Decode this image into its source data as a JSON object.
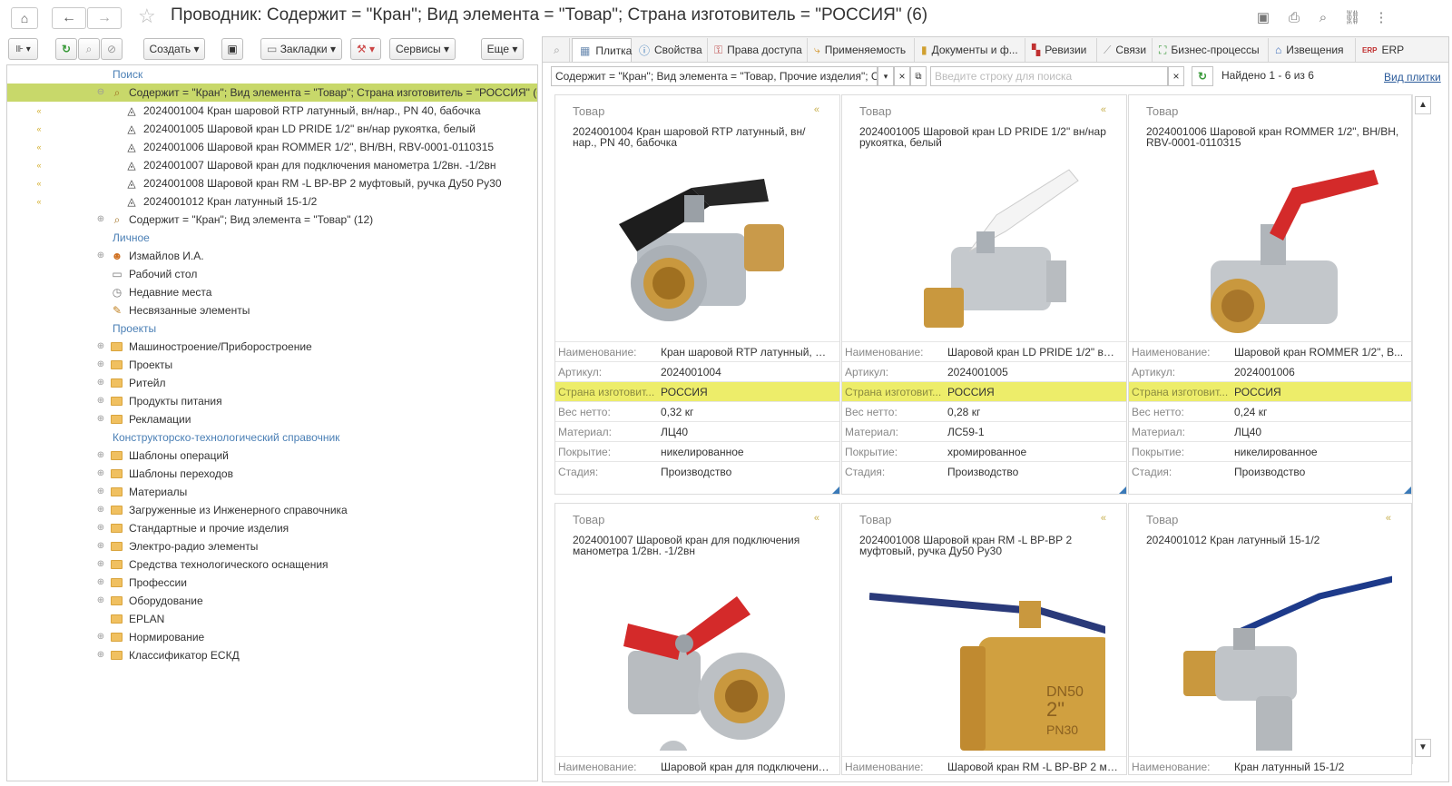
{
  "window": {
    "title": "Проводник: Содержит = \"Кран\"; Вид элемента = \"Товар\"; Страна изготовитель = \"РОССИЯ\" (6)"
  },
  "icons": [
    "home-icon",
    "back-icon",
    "forward-icon",
    "star-icon",
    "save-icon",
    "print-icon",
    "preview-icon",
    "link-icon",
    "more-vert-icon"
  ],
  "toolbar": {
    "create": "Создать",
    "bookmarks": "Закладки",
    "services": "Сервисы",
    "more": "Еще"
  },
  "tree": {
    "search_section": "Поиск",
    "query1": "Содержит = \"Кран\"; Вид элемента = \"Товар\"; Страна изготовитель = \"РОССИЯ\" (6)",
    "items": [
      "2024001004 Кран шаровой RTP латунный, вн/нар., PN 40, бабочка",
      "2024001005 Шаровой кран LD PRIDE 1/2\" вн/нар рукоятка, белый",
      "2024001006 Шаровой кран ROMMER 1/2\", ВН/ВН, RBV-0001-0110315",
      "2024001007 Шаровой кран для подключения манометра 1/2вн. -1/2вн",
      "2024001008 Шаровой кран RM -L ВР-ВР 2 муфтовый, ручка Ду50 Ру30",
      "2024001012 Кран латунный 15-1/2"
    ],
    "query2": "Содержит = \"Кран\"; Вид элемента = \"Товар\" (12)",
    "personal_section": "Личное",
    "personal": [
      "Измайлов И.А.",
      "Рабочий стол",
      "Недавние места",
      "Несвязанные элементы"
    ],
    "projects_section": "Проекты",
    "projects": [
      "Машиностроение/Приборостроение",
      "Проекты",
      "Ритейл",
      "Продукты питания",
      "Рекламации"
    ],
    "ktc_section": "Конструкторско-технологический справочник",
    "ktc": [
      "Шаблоны операций",
      "Шаблоны переходов",
      "Материалы",
      "Загруженные из Инженерного справочника",
      "Стандартные и прочие изделия",
      "Электро-радио элементы",
      "Средства технологического оснащения",
      "Профессии",
      "Оборудование",
      "EPLAN",
      "Нормирование",
      "Классификатор ЕСКД"
    ]
  },
  "tabs": [
    "Плитка",
    "Свойства",
    "Права доступа",
    "Применяемость",
    "Документы и ф...",
    "Ревизии",
    "Связи",
    "Бизнес-процессы",
    "Извещения",
    "ERP"
  ],
  "filterbar": {
    "query": "Содержит = \"Кран\"; Вид элемента = \"Товар, Прочие изделия\"; С",
    "search_placeholder": "Введите строку для поиска",
    "found": "Найдено 1 - 6 из 6",
    "tile_view": "Вид плитки"
  },
  "attr_labels": [
    "Наименование:",
    "Артикул:",
    "Страна изготовит...",
    "Вес нетто:",
    "Материал:",
    "Покрытие:",
    "Стадия:"
  ],
  "cards": [
    {
      "type": "Товар",
      "title": "2024001004 Кран шаровой RTP латунный, вн/нар., PN 40, бабочка",
      "values": [
        "Кран шаровой RTP латунный, вн...",
        "2024001004",
        "РОССИЯ",
        "0,32 кг",
        "ЛЦ40",
        "никелированное",
        "Производство"
      ]
    },
    {
      "type": "Товар",
      "title": "2024001005 Шаровой кран LD PRIDE 1/2\" вн/нар рукоятка, белый",
      "values": [
        "Шаровой кран LD PRIDE 1/2\" вн/...",
        "2024001005",
        "РОССИЯ",
        "0,28 кг",
        "ЛС59-1",
        "хромированное",
        "Производство"
      ]
    },
    {
      "type": "Товар",
      "title": "2024001006 Шаровой кран ROMMER 1/2\", ВН/ВН, RBV-0001-0110315",
      "values": [
        "Шаровой кран ROMMER 1/2\", В...",
        "2024001006",
        "РОССИЯ",
        "0,24 кг",
        "ЛЦ40",
        "никелированное",
        "Производство"
      ]
    },
    {
      "type": "Товар",
      "title": "2024001007 Шаровой кран для подключения манометра 1/2вн. -1/2вн",
      "values": [
        "Шаровой кран для подключения ..."
      ]
    },
    {
      "type": "Товар",
      "title": "2024001008 Шаровой кран RM -L ВР-ВР 2 муфтовый, ручка Ду50 Ру30",
      "values": [
        "Шаровой кран RM -L ВР-ВР 2 му..."
      ]
    },
    {
      "type": "Товар",
      "title": "2024001012 Кран латунный 15-1/2",
      "values": [
        "Кран латунный 15-1/2"
      ]
    }
  ],
  "valve_labels": {
    "size": "2\"",
    "dn": "DN50",
    "pn": "PN30"
  },
  "colors": {
    "selection": "#c8d86a",
    "highlight": "#eded6a",
    "link": "#4a7fb5",
    "accent_red": "#d42a2a"
  }
}
